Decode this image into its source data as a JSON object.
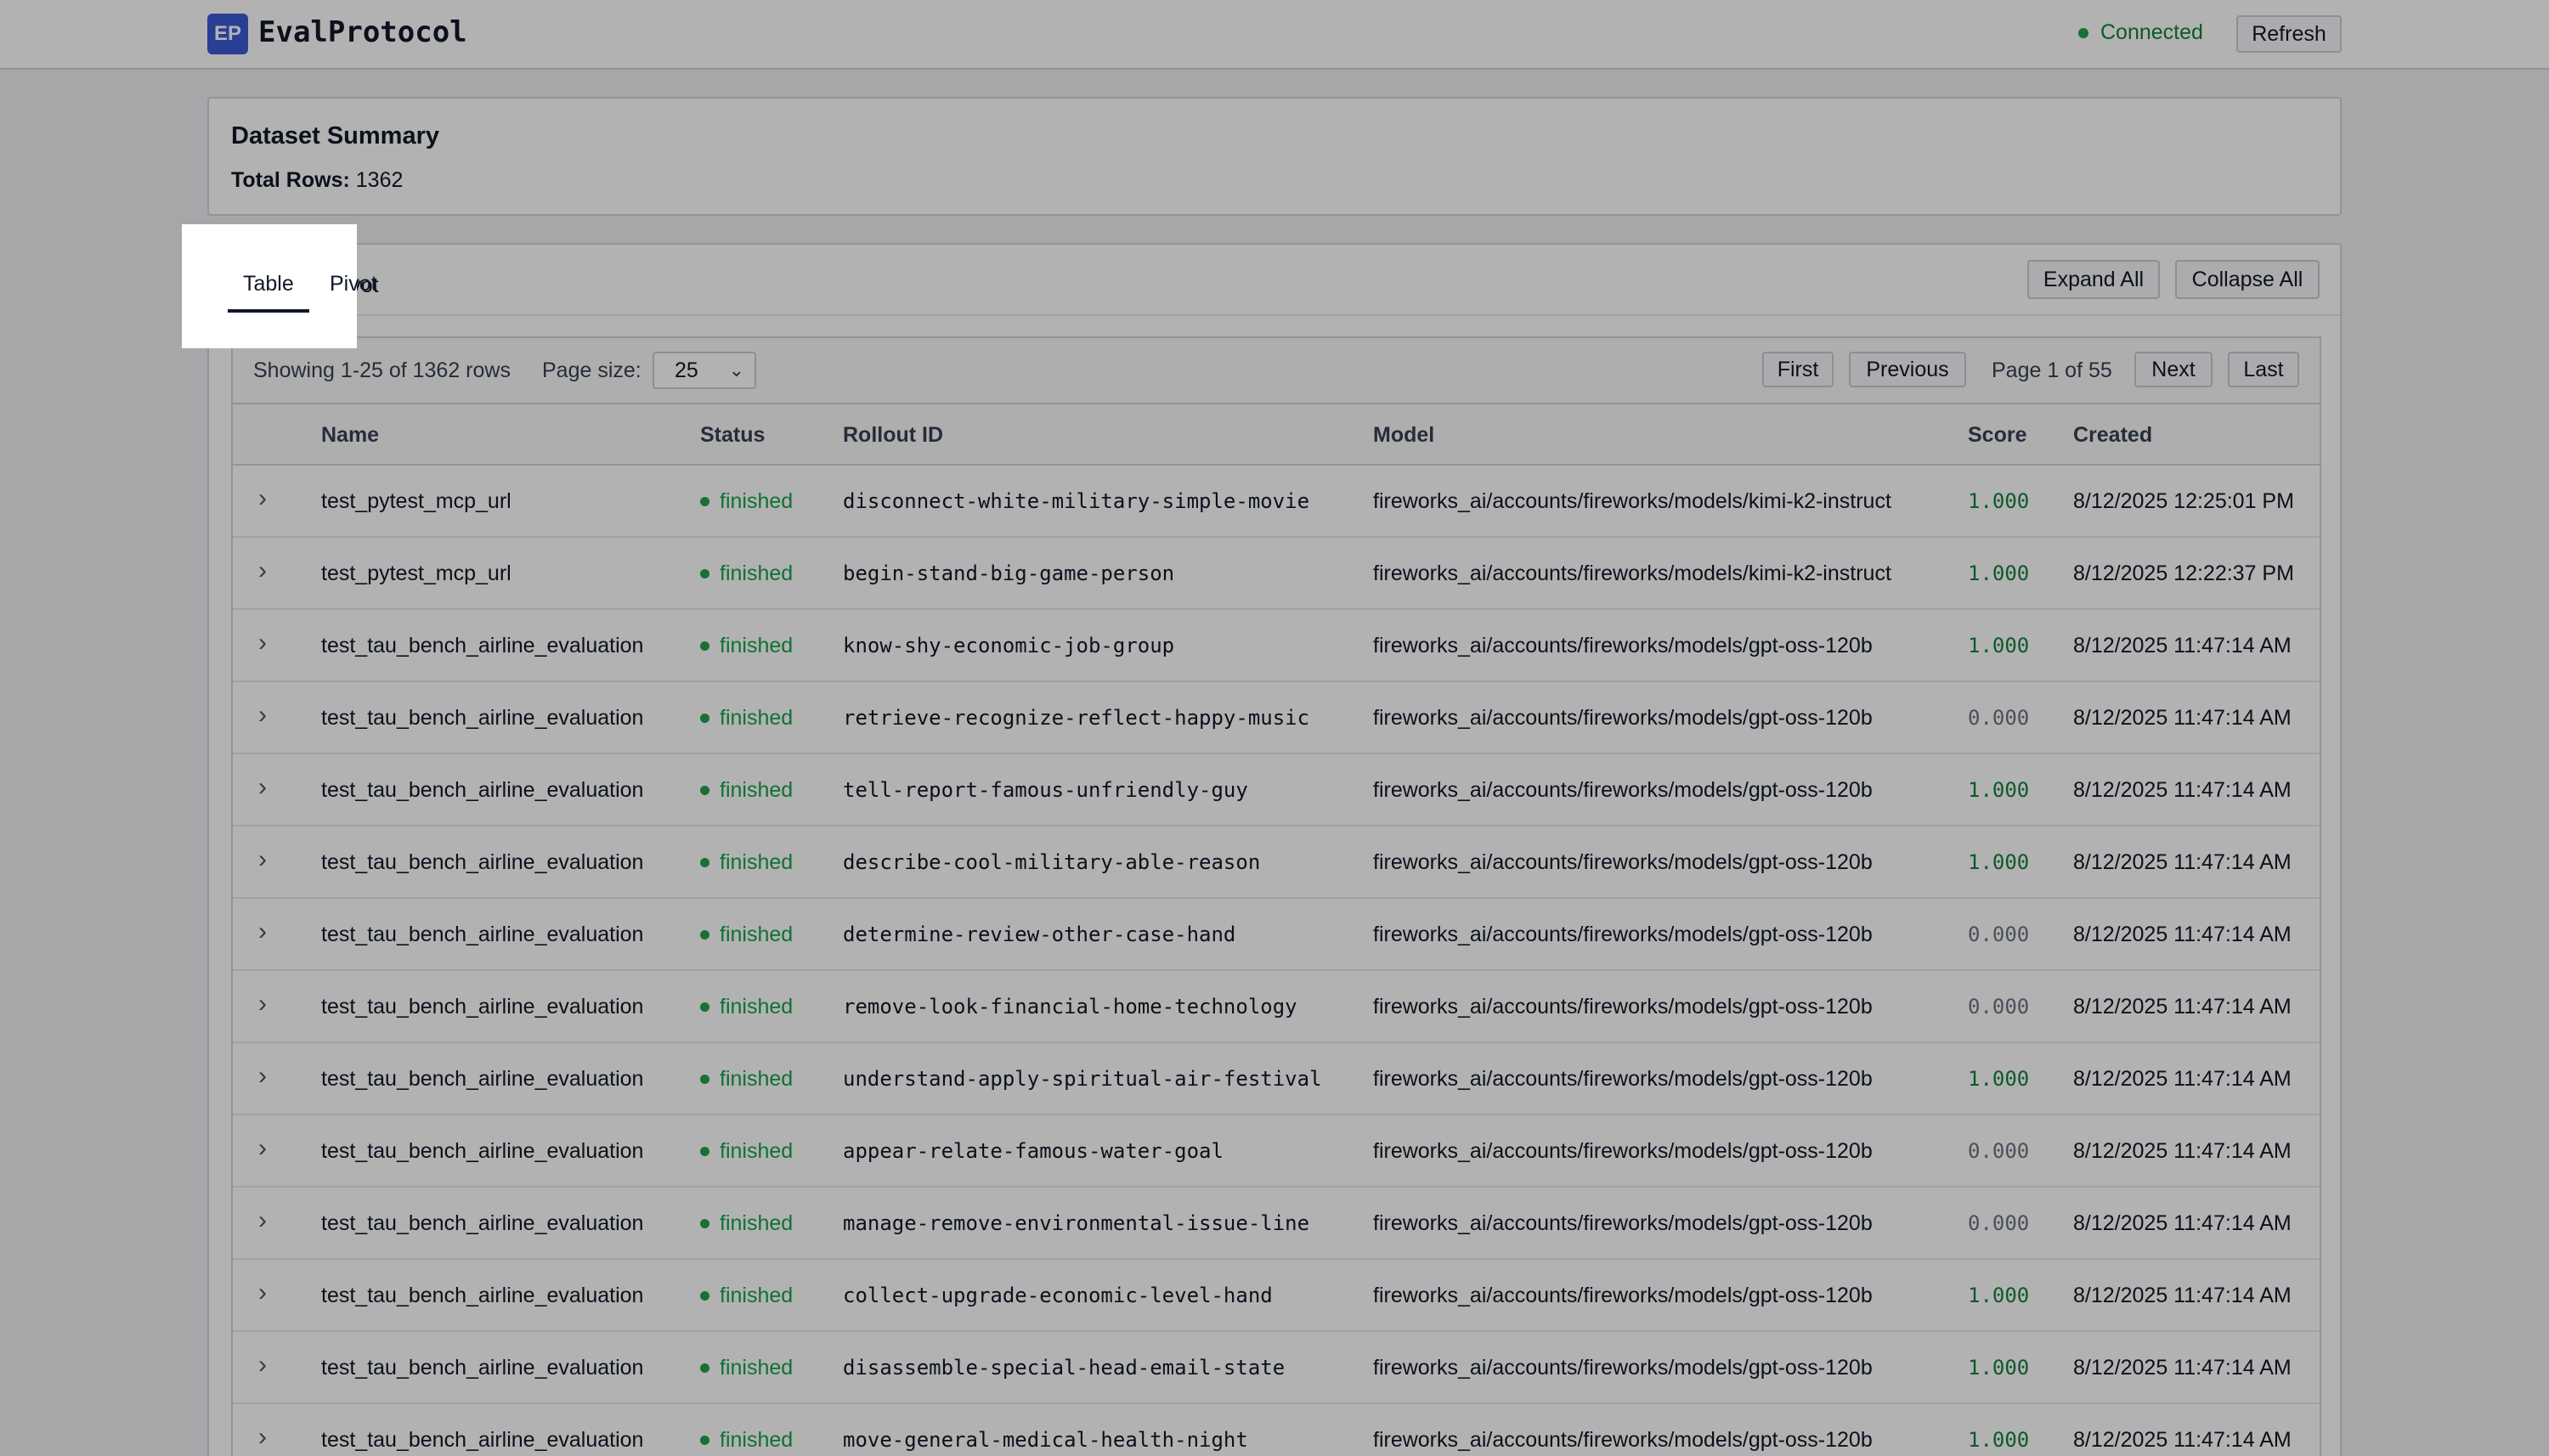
{
  "header": {
    "logo_text": "EP",
    "app_title": "EvalProtocol",
    "status_text": "Connected",
    "refresh_label": "Refresh",
    "status_color": "#22a34a"
  },
  "summary": {
    "title": "Dataset Summary",
    "rows_label": "Total Rows:",
    "rows_value": "1362"
  },
  "tabs": [
    {
      "label": "Table",
      "active": true
    },
    {
      "label": "Pivot",
      "active": false
    }
  ],
  "actions": {
    "expand_all": "Expand All",
    "collapse_all": "Collapse All"
  },
  "pager": {
    "showing": "Showing 1-25 of 1362 rows",
    "page_size_label": "Page size:",
    "page_size_value": "25",
    "first": "First",
    "previous": "Previous",
    "page_info": "Page 1 of 55",
    "next": "Next",
    "last": "Last"
  },
  "columns": [
    "Name",
    "Status",
    "Rollout ID",
    "Model",
    "Score",
    "Created"
  ],
  "rows": [
    {
      "name": "test_pytest_mcp_url",
      "status": "finished",
      "rollout_id": "disconnect-white-military-simple-movie",
      "model": "fireworks_ai/accounts/fireworks/models/kimi-k2-instruct",
      "score": "1.000",
      "created": "8/12/2025 12:25:01 PM"
    },
    {
      "name": "test_pytest_mcp_url",
      "status": "finished",
      "rollout_id": "begin-stand-big-game-person",
      "model": "fireworks_ai/accounts/fireworks/models/kimi-k2-instruct",
      "score": "1.000",
      "created": "8/12/2025 12:22:37 PM"
    },
    {
      "name": "test_tau_bench_airline_evaluation",
      "status": "finished",
      "rollout_id": "know-shy-economic-job-group",
      "model": "fireworks_ai/accounts/fireworks/models/gpt-oss-120b",
      "score": "1.000",
      "created": "8/12/2025 11:47:14 AM"
    },
    {
      "name": "test_tau_bench_airline_evaluation",
      "status": "finished",
      "rollout_id": "retrieve-recognize-reflect-happy-music",
      "model": "fireworks_ai/accounts/fireworks/models/gpt-oss-120b",
      "score": "0.000",
      "created": "8/12/2025 11:47:14 AM"
    },
    {
      "name": "test_tau_bench_airline_evaluation",
      "status": "finished",
      "rollout_id": "tell-report-famous-unfriendly-guy",
      "model": "fireworks_ai/accounts/fireworks/models/gpt-oss-120b",
      "score": "1.000",
      "created": "8/12/2025 11:47:14 AM"
    },
    {
      "name": "test_tau_bench_airline_evaluation",
      "status": "finished",
      "rollout_id": "describe-cool-military-able-reason",
      "model": "fireworks_ai/accounts/fireworks/models/gpt-oss-120b",
      "score": "1.000",
      "created": "8/12/2025 11:47:14 AM"
    },
    {
      "name": "test_tau_bench_airline_evaluation",
      "status": "finished",
      "rollout_id": "determine-review-other-case-hand",
      "model": "fireworks_ai/accounts/fireworks/models/gpt-oss-120b",
      "score": "0.000",
      "created": "8/12/2025 11:47:14 AM"
    },
    {
      "name": "test_tau_bench_airline_evaluation",
      "status": "finished",
      "rollout_id": "remove-look-financial-home-technology",
      "model": "fireworks_ai/accounts/fireworks/models/gpt-oss-120b",
      "score": "0.000",
      "created": "8/12/2025 11:47:14 AM"
    },
    {
      "name": "test_tau_bench_airline_evaluation",
      "status": "finished",
      "rollout_id": "understand-apply-spiritual-air-festival",
      "model": "fireworks_ai/accounts/fireworks/models/gpt-oss-120b",
      "score": "1.000",
      "created": "8/12/2025 11:47:14 AM"
    },
    {
      "name": "test_tau_bench_airline_evaluation",
      "status": "finished",
      "rollout_id": "appear-relate-famous-water-goal",
      "model": "fireworks_ai/accounts/fireworks/models/gpt-oss-120b",
      "score": "0.000",
      "created": "8/12/2025 11:47:14 AM"
    },
    {
      "name": "test_tau_bench_airline_evaluation",
      "status": "finished",
      "rollout_id": "manage-remove-environmental-issue-line",
      "model": "fireworks_ai/accounts/fireworks/models/gpt-oss-120b",
      "score": "0.000",
      "created": "8/12/2025 11:47:14 AM"
    },
    {
      "name": "test_tau_bench_airline_evaluation",
      "status": "finished",
      "rollout_id": "collect-upgrade-economic-level-hand",
      "model": "fireworks_ai/accounts/fireworks/models/gpt-oss-120b",
      "score": "1.000",
      "created": "8/12/2025 11:47:14 AM"
    },
    {
      "name": "test_tau_bench_airline_evaluation",
      "status": "finished",
      "rollout_id": "disassemble-special-head-email-state",
      "model": "fireworks_ai/accounts/fireworks/models/gpt-oss-120b",
      "score": "1.000",
      "created": "8/12/2025 11:47:14 AM"
    },
    {
      "name": "test_tau_bench_airline_evaluation",
      "status": "finished",
      "rollout_id": "move-general-medical-health-night",
      "model": "fireworks_ai/accounts/fireworks/models/gpt-oss-120b",
      "score": "1.000",
      "created": "8/12/2025 11:47:14 AM"
    }
  ],
  "icons": {
    "row_expander": "chevron-right-icon",
    "select_caret": "chevron-down-icon",
    "status_dot": "status-dot-icon"
  },
  "colors": {
    "brand": "#3b5bd6",
    "success": "#16a34a",
    "score_pass": "#15803d",
    "score_fail": "#6b7280"
  }
}
